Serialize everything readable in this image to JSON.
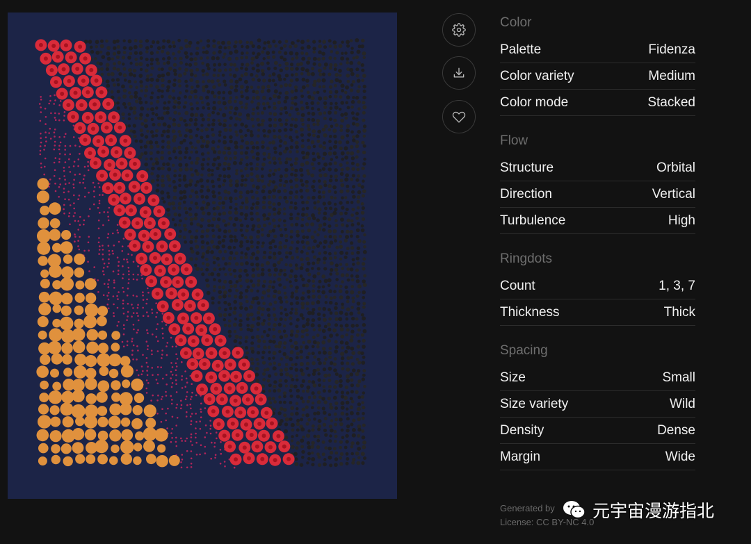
{
  "colors": {
    "background": "#121212",
    "canvas": "#1c2447",
    "red": "#d92b3a",
    "red_inner": "#a8121f",
    "orange": "#e0913d",
    "dark_dot": "#2a2a2a",
    "muted_text": "#6e6e6e"
  },
  "toolbar": {
    "settings_icon": "gear-icon",
    "download_icon": "download-icon",
    "like_icon": "heart-icon"
  },
  "panel": {
    "sections": [
      {
        "title": "Color",
        "rows": [
          {
            "label": "Palette",
            "value": "Fidenza"
          },
          {
            "label": "Color variety",
            "value": "Medium"
          },
          {
            "label": "Color mode",
            "value": "Stacked"
          }
        ]
      },
      {
        "title": "Flow",
        "rows": [
          {
            "label": "Structure",
            "value": "Orbital"
          },
          {
            "label": "Direction",
            "value": "Vertical"
          },
          {
            "label": "Turbulence",
            "value": "High"
          }
        ]
      },
      {
        "title": "Ringdots",
        "rows": [
          {
            "label": "Count",
            "value": "1, 3, 7"
          },
          {
            "label": "Thickness",
            "value": "Thick"
          }
        ]
      },
      {
        "title": "Spacing",
        "rows": [
          {
            "label": "Size",
            "value": "Small"
          },
          {
            "label": "Size variety",
            "value": "Wild"
          },
          {
            "label": "Density",
            "value": "Dense"
          },
          {
            "label": "Margin",
            "value": "Wide"
          }
        ]
      }
    ]
  },
  "footer": {
    "generated_by": "Generated by",
    "license": "License: CC BY-NC 4.0"
  },
  "watermark": {
    "text": "元宇宙漫游指北",
    "icon": "wechat-icon"
  }
}
